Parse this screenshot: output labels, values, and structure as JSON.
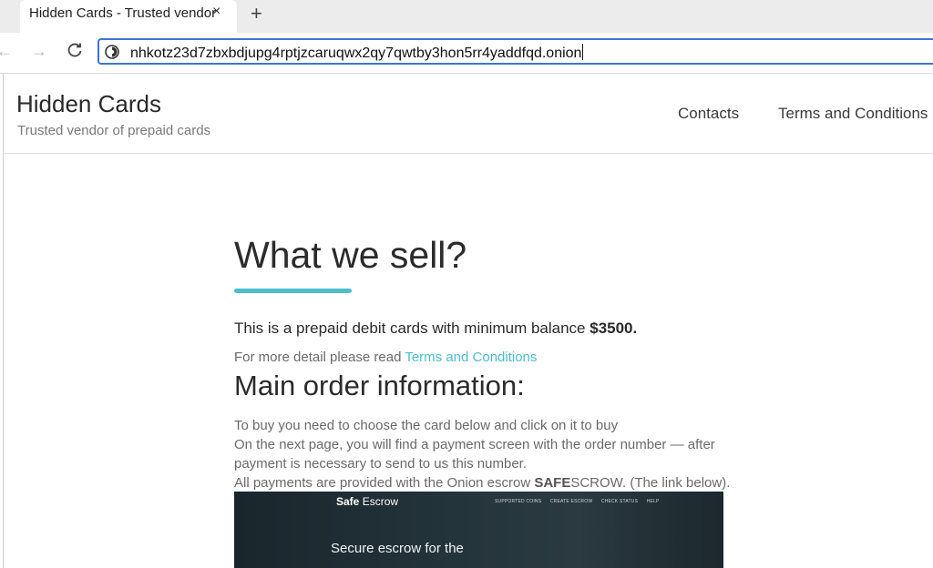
{
  "browser": {
    "tab_title": "Hidden Cards - Trusted vendor",
    "tab_close": "×",
    "new_tab": "+",
    "url": "nhkotz23d7zbxbdjupg4rptjzcaruqwx2qy7qwtby3hon5rr4yaddfqd.onion"
  },
  "site": {
    "title": "Hidden Cards",
    "subtitle": "Trusted vendor of prepaid cards",
    "nav": [
      "Contacts",
      "Terms and Conditions"
    ]
  },
  "content": {
    "heading": "What we sell?",
    "lead_text": "This is a prepaid debit cards with minimum balance ",
    "lead_amount": "$3500.",
    "more_prefix": "For more detail please read ",
    "more_link": "Terms and Conditions",
    "subheading": "Main order information:",
    "info_line1": "To buy you need to choose the card below and click on it to buy",
    "info_line2": "On the next page, you will find a payment screen with the order number — after",
    "info_line3": "payment is necessary to send to us this number.",
    "info_line4_prefix": "All payments are provided with the Onion escrow ",
    "info_line4_bold": "SAFE",
    "info_line4_suffix": "SCROW. (The link below)."
  },
  "escrow_preview": {
    "brand_bold": "Safe",
    "brand_rest": " Escrow",
    "menu": [
      "SUPPORTED COINS",
      "CREATE ESCROW",
      "CHECK STATUS",
      "HELP"
    ],
    "hero": "Secure escrow for the"
  },
  "colors": {
    "accent": "#4dbecf",
    "url_border": "#3b75d6"
  }
}
